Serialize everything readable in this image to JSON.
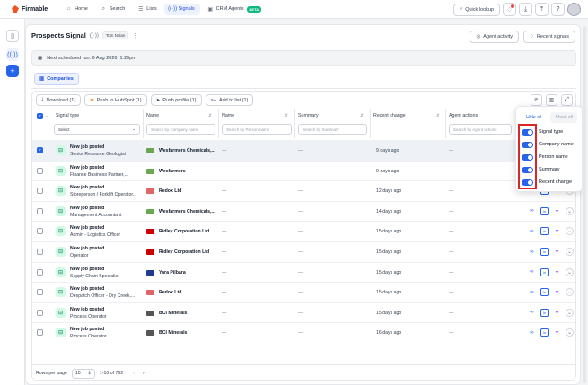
{
  "app": {
    "brand": "Firmable",
    "nav": [
      {
        "label": "Home",
        "icon": "home-icon"
      },
      {
        "label": "Search",
        "icon": "search-icon"
      },
      {
        "label": "Lists",
        "icon": "list-icon"
      },
      {
        "label": "Signals",
        "icon": "signal-icon"
      },
      {
        "label": "CRM Agents",
        "icon": "robot-icon",
        "badge": "BETA"
      }
    ],
    "quick_lookup": "Quick lookup",
    "active_nav": "Signals"
  },
  "page": {
    "title": "Prospects Signal",
    "owner": "Tom Nolan",
    "agent_activity": "Agent activity",
    "recent_signals": "Recent signals",
    "schedule": "Next scheduled run: 6 Aug 2026, 1:29pm",
    "tab": "Companies"
  },
  "toolbar": {
    "download": "Download (1)",
    "hubspot": "Push to HubSpot (1)",
    "push_profile": "Push profile (1)",
    "add_list": "Add to list (1)"
  },
  "table": {
    "headers": {
      "signal_type": "Signal type",
      "name1": "Name",
      "name2": "Name",
      "summary": "Summary",
      "recent_change": "Recent change",
      "agent_actions": "Agent actions"
    },
    "filters": {
      "signal_type": "Select",
      "company": "Search by Company name",
      "person": "Search by Person name",
      "summary": "Search by Summary",
      "agent": "Search by Agent actions"
    },
    "rows": [
      {
        "type": "New job posted",
        "role": "Senior Resource Geologist",
        "company": "Wesfarmers Chemicals,...",
        "logo_color": "#6aa84f",
        "change": "9 days ago",
        "selected": true
      },
      {
        "type": "New job posted",
        "role": "Finance Business Partner,...",
        "company": "Wesfarmers",
        "logo_color": "#6aa84f",
        "change": "9 days ago",
        "selected": false
      },
      {
        "type": "New job posted",
        "role": "Storeperson / Forklift Operator...",
        "company": "Redox Ltd",
        "logo_color": "#e06666",
        "change": "12 days ago",
        "selected": false
      },
      {
        "type": "New job posted",
        "role": "Management Accountant",
        "company": "Wesfarmers Chemicals,...",
        "logo_color": "#6aa84f",
        "change": "14 days ago",
        "selected": false
      },
      {
        "type": "New job posted",
        "role": "Admin - Logistics Officer",
        "company": "Ridley Corporation Ltd",
        "logo_color": "#cc0000",
        "change": "15 days ago",
        "selected": false
      },
      {
        "type": "New job posted",
        "role": "Operator",
        "company": "Ridley Corporation Ltd",
        "logo_color": "#cc0000",
        "change": "15 days ago",
        "selected": false
      },
      {
        "type": "New job posted",
        "role": "Supply Chain Specialist",
        "company": "Yara Pilbara",
        "logo_color": "#1f3a93",
        "change": "15 days ago",
        "selected": false
      },
      {
        "type": "New job posted",
        "role": "Despatch Officer - Dry Creek,...",
        "company": "Redox Ltd",
        "logo_color": "#e06666",
        "change": "15 days ago",
        "selected": false
      },
      {
        "type": "New job posted",
        "role": "Process Operator",
        "company": "BCI Minerals",
        "logo_color": "#555555",
        "change": "15 days ago",
        "selected": false
      },
      {
        "type": "New job posted",
        "role": "Process Operator",
        "company": "BCI Minerals",
        "logo_color": "#555555",
        "change": "16 days ago",
        "selected": false
      }
    ],
    "dash": "—"
  },
  "footer": {
    "rows_per_page_label": "Rows per page",
    "rows_per_page": "10",
    "range": "1-10 of 762"
  },
  "columns_menu": {
    "hide_all": "Hide all",
    "show_all": "Show all",
    "items": [
      "Signal type",
      "Company name",
      "Person name",
      "Summary",
      "Recent change"
    ]
  },
  "colors": {
    "accent": "#2563eb",
    "highlight": "#dc2626",
    "beta": "#10b981"
  }
}
